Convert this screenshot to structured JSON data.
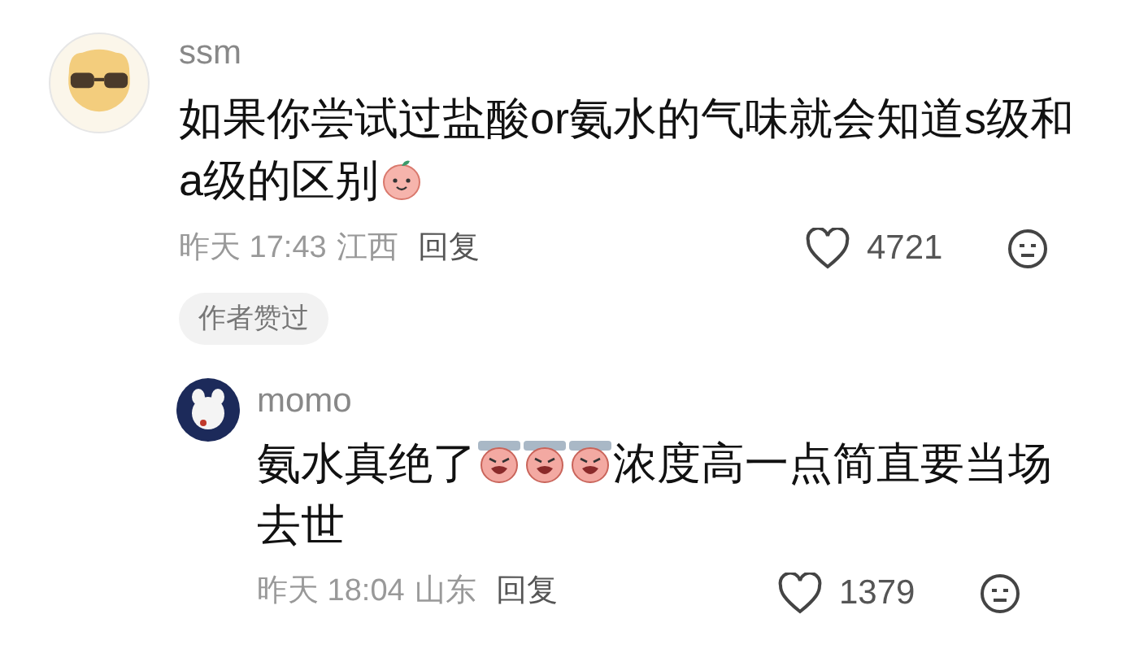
{
  "comments": [
    {
      "user": "ssm",
      "segments": [
        {
          "kind": "text",
          "text": "如果你尝试过盐酸or氨水的气味就会知道s级和a级的区别"
        },
        {
          "kind": "smile"
        }
      ],
      "time": "昨天 17:43",
      "location": "江西",
      "reply": "回复",
      "likes": "4721",
      "badge": "作者赞过",
      "replies": [
        {
          "user": "momo",
          "segments": [
            {
              "kind": "text",
              "text": "氨水真绝了"
            },
            {
              "kind": "shout"
            },
            {
              "kind": "shout"
            },
            {
              "kind": "shout"
            },
            {
              "kind": "text",
              "text": "浓度高一点简直要当场去世"
            }
          ],
          "time": "昨天 18:04",
          "location": "山东",
          "reply": "回复",
          "likes": "1379"
        }
      ]
    }
  ]
}
